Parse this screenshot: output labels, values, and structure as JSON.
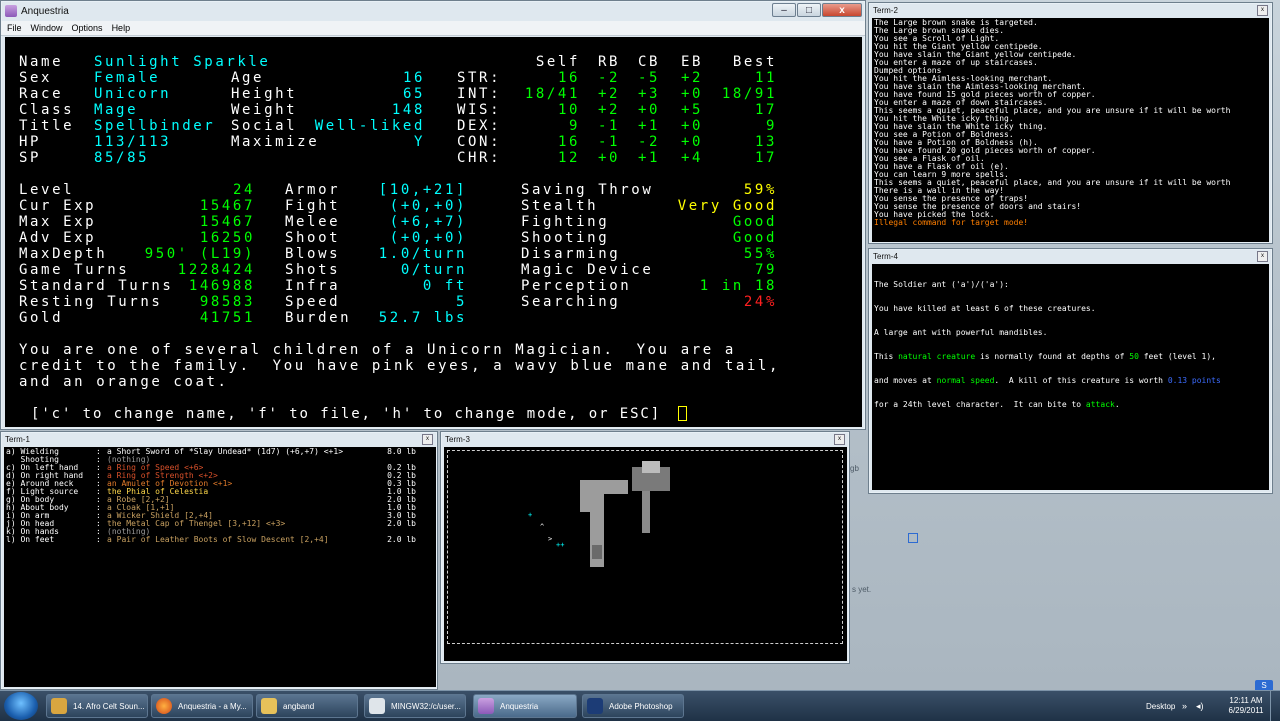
{
  "main_window": {
    "title": "Anquestria",
    "menu": [
      "File",
      "Window",
      "Options",
      "Help"
    ]
  },
  "term1_title": "Term-1",
  "term2_title": "Term-2",
  "term3_title": "Term-3",
  "term4_title": "Term-4",
  "char": {
    "labels": {
      "name": "Name",
      "sex": "Sex",
      "race": "Race",
      "class": "Class",
      "title": "Title",
      "hp": "HP",
      "sp": "SP",
      "age": "Age",
      "height": "Height",
      "weight": "Weight",
      "social": "Social",
      "maximize": "Maximize"
    },
    "name": "Sunlight Sparkle",
    "sex": "Female",
    "race": "Unicorn",
    "class": "Mage",
    "title": "Spellbinder",
    "hp": "113/113",
    "sp": "85/85",
    "age": "16",
    "height": "65",
    "weight": "148",
    "social": "Well-liked",
    "maximize": "Y"
  },
  "stats": {
    "header": [
      "Self",
      "RB",
      "CB",
      "EB",
      "Best"
    ],
    "rows": [
      {
        "n": "STR:",
        "self": "16",
        "rb": "-2",
        "cb": "-5",
        "eb": "+2",
        "best": "11"
      },
      {
        "n": "INT:",
        "self": "18/41",
        "rb": "+2",
        "cb": "+3",
        "eb": "+0",
        "best": "18/91"
      },
      {
        "n": "WIS:",
        "self": "10",
        "rb": "+2",
        "cb": "+0",
        "eb": "+5",
        "best": "17"
      },
      {
        "n": "DEX:",
        "self": "9",
        "rb": "-1",
        "cb": "+1",
        "eb": "+0",
        "best": "9"
      },
      {
        "n": "CON:",
        "self": "16",
        "rb": "-1",
        "cb": "-2",
        "eb": "+0",
        "best": "13"
      },
      {
        "n": "CHR:",
        "self": "12",
        "rb": "+0",
        "cb": "+1",
        "eb": "+4",
        "best": "17"
      }
    ]
  },
  "progress": [
    {
      "l": "Level",
      "v": "24"
    },
    {
      "l": "Cur Exp",
      "v": "15467"
    },
    {
      "l": "Max Exp",
      "v": "15467"
    },
    {
      "l": "Adv Exp",
      "v": "16250"
    },
    {
      "l": "MaxDepth",
      "v": "950' (L19)"
    },
    {
      "l": "Game Turns",
      "v": "1228424"
    },
    {
      "l": "Standard Turns",
      "v": "146988"
    },
    {
      "l": "Resting Turns",
      "v": "98583"
    },
    {
      "l": "Gold",
      "v": "41751"
    }
  ],
  "combat": [
    {
      "l": "Armor",
      "v": "[10,+21]"
    },
    {
      "l": "Fight",
      "v": "(+0,+0)"
    },
    {
      "l": "Melee",
      "v": "(+6,+7)"
    },
    {
      "l": "Shoot",
      "v": "(+0,+0)"
    },
    {
      "l": "Blows",
      "v": "1.0/turn"
    },
    {
      "l": "Shots",
      "v": "0/turn"
    },
    {
      "l": "Infra",
      "v": "0 ft"
    },
    {
      "l": "Speed",
      "v": "5"
    },
    {
      "l": "Burden",
      "v": "52.7 lbs"
    }
  ],
  "skills": [
    {
      "l": "Saving Throw",
      "v": "59%"
    },
    {
      "l": "Stealth",
      "v": "Very Good"
    },
    {
      "l": "Fighting",
      "v": "Good"
    },
    {
      "l": "Shooting",
      "v": "Good"
    },
    {
      "l": "Disarming",
      "v": "55%"
    },
    {
      "l": "Magic Device",
      "v": "79"
    },
    {
      "l": "Perception",
      "v": "1 in 18"
    },
    {
      "l": "Searching",
      "v": "24%"
    }
  ],
  "history": [
    "You are one of several children of a Unicorn Magician.  You are a",
    "credit to the family.  You have pink eyes, a wavy blue mane and tail,",
    "and an orange coat."
  ],
  "prompt": "['c' to change name, 'f' to file, 'h' to change mode, or ESC]",
  "messages": [
    "The Large brown snake is targeted.",
    "The Large brown snake dies.",
    "You see a Scroll of Light.",
    "You hit the Giant yellow centipede.",
    "You have slain the Giant yellow centipede.",
    "You enter a maze of up staircases.",
    "Dumped options",
    "You hit the Aimless-looking merchant.",
    "You have slain the Aimless-looking merchant.",
    "You have found 15 gold pieces worth of copper.",
    "You enter a maze of down staircases.",
    "This seems a quiet, peaceful place, and you are unsure if it will be worth",
    "You hit the White icky thing.",
    "You have slain the White icky thing.",
    "You see a Potion of Boldness.",
    "You have a Potion of Boldness (h).",
    "You have found 20 gold pieces worth of copper.",
    "You see a Flask of oil.",
    "You have a Flask of oil (e).",
    "You can learn 9 more spells.",
    "This seems a quiet, peaceful place, and you are unsure if it will be worth",
    "There is a wall in the way!",
    "You sense the presence of traps!",
    "You sense the presence of doors and stairs!",
    "You have picked the lock.",
    "Illegal command for target mode!"
  ],
  "monster_recall": {
    "line1": "The Soldier ant ('a')/('a'):",
    "line2": "You have killed at least 6 of these creatures.",
    "line3": "A large ant with powerful mandibles.",
    "line4_a": "This ",
    "line4_b": "natural creature",
    "line4_c": " is normally found at depths of ",
    "line4_d": "50",
    "line4_e": " feet (level 1),",
    "line5_a": "and moves at ",
    "line5_b": "normal speed",
    "line5_c": ".  A kill of this creature is worth ",
    "line5_d": "0.13 points",
    "line6_a": "for a 24th level character.  It can bite to ",
    "line6_b": "attack",
    "line6_c": "."
  },
  "equipment": [
    {
      "slot": "a) Wielding",
      "item": "a Short Sword of *Slay Undead* (1d7) (+6,+7) <+1>",
      "wt": "8.0 lb",
      "color": "#ffffff"
    },
    {
      "slot": "   Shooting",
      "item": "(nothing)",
      "wt": "",
      "color": "#9a9a9a"
    },
    {
      "slot": "c) On left hand",
      "item": "a Ring of Speed <+6>",
      "wt": "0.2 lb",
      "color": "#d8502a"
    },
    {
      "slot": "d) On right hand",
      "item": "a Ring of Strength <+2>",
      "wt": "0.2 lb",
      "color": "#d8502a"
    },
    {
      "slot": "e) Around neck",
      "item": "an Amulet of Devotion <+1>",
      "wt": "0.3 lb",
      "color": "#e07a2a"
    },
    {
      "slot": "f) Light source",
      "item": "the Phial of Celestia",
      "wt": "1.0 lb",
      "color": "#ffd84a"
    },
    {
      "slot": "g) On body",
      "item": "a Robe [2,+2]",
      "wt": "2.0 lb",
      "color": "#c8a060"
    },
    {
      "slot": "h) About body",
      "item": "a Cloak [1,+1]",
      "wt": "1.0 lb",
      "color": "#c8a060"
    },
    {
      "slot": "i) On arm",
      "item": "a Wicker Shield [2,+4]",
      "wt": "3.0 lb",
      "color": "#c8a060"
    },
    {
      "slot": "j) On head",
      "item": "the Metal Cap of Thengel [3,+12] <+3>",
      "wt": "2.0 lb",
      "color": "#c8a060"
    },
    {
      "slot": "k) On hands",
      "item": "(nothing)",
      "wt": "",
      "color": "#9a9a9a"
    },
    {
      "slot": "l) On feet",
      "item": "a Pair of Leather Boots of Slow Descent [2,+4]",
      "wt": "2.0 lb",
      "color": "#c8a060"
    }
  ],
  "bg_text": {
    "gb": "gb",
    "yet": "s yet."
  },
  "taskbar": {
    "items": [
      "14. Afro Celt Soun...",
      "Anquestria - a My...",
      "angband",
      "MINGW32:/c/user...",
      "Anquestria",
      "Adobe Photoshop"
    ],
    "desktop": "Desktop",
    "time": "12:11 AM",
    "date": "6/29/2011"
  },
  "colors": {
    "cyan": "#00ffff",
    "green": "#00ff00",
    "yellow": "#ffff00",
    "red": "#ff2020",
    "orange": "#ff7f00",
    "blue": "#3c6cff"
  }
}
